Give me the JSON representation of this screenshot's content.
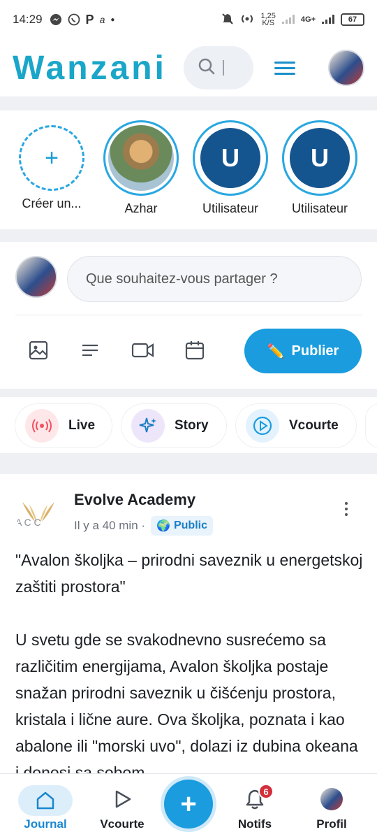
{
  "status": {
    "time": "14:29",
    "speed": "1,25",
    "speed_unit": "K/S",
    "network": "4G+",
    "battery": "67"
  },
  "header": {
    "logo_part1": "Wa",
    "logo_part2": "nzani",
    "search_icon": "search-icon",
    "menu_icon": "hamburger-icon"
  },
  "stories": [
    {
      "label": "Créer un...",
      "type": "create"
    },
    {
      "label": "Azhar",
      "type": "photo"
    },
    {
      "label": "Utilisateur",
      "type": "initial",
      "initial": "U"
    },
    {
      "label": "Utilisateur",
      "type": "initial",
      "initial": "U"
    }
  ],
  "composer": {
    "placeholder": "Que souhaitez-vous partager ?",
    "publish_label": "Publier",
    "publish_emoji": "✏️"
  },
  "quick_actions": [
    {
      "label": "Live",
      "icon": "live-icon",
      "color": "#f0525e"
    },
    {
      "label": "Story",
      "icon": "sparkle-icon",
      "color": "#7b5cd6"
    },
    {
      "label": "Vcourte",
      "icon": "play-icon",
      "color": "#1a9cde"
    }
  ],
  "post": {
    "author": "Evolve Academy",
    "time": "Il y a 40 min ·",
    "visibility": "Public",
    "visibility_icon": "🌍",
    "paragraph1": "\"Avalon školjka – prirodni saveznik u energetskoj zaštiti prostora\"",
    "paragraph2": "U svetu gde se svakodnevno susrećemo sa različitim energijama, Avalon školjka postaje snažan prirodni saveznik u čišćenju prostora, kristala i lične aure. Ova školjka, poznata i kao abalone ili \"morski uvo\", dolazi iz dubina okeana i donosi sa sobom"
  },
  "bottom_nav": {
    "journal": "Journal",
    "vcourte": "Vcourte",
    "notifs": "Notifs",
    "notif_count": "6",
    "profil": "Profil"
  },
  "colors": {
    "accent": "#1a9cde",
    "logo_blue": "#1aa6c9",
    "logo_red": "#d9223b",
    "story_user": "#15558f"
  }
}
